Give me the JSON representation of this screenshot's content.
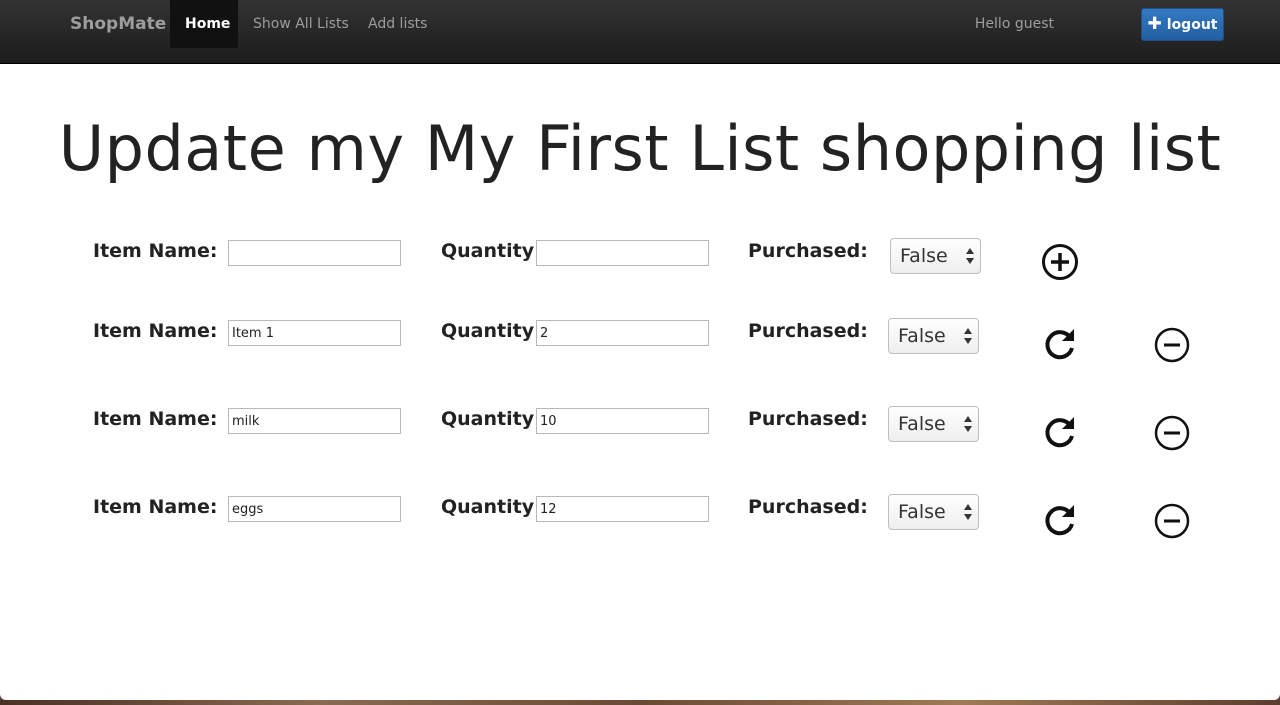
{
  "navbar": {
    "brand": "ShopMate",
    "items": [
      {
        "label": "Home",
        "active": true
      },
      {
        "label": "Show All Lists",
        "active": false
      },
      {
        "label": "Add lists",
        "active": false
      }
    ],
    "greeting": "Hello guest",
    "logout_label": "logout",
    "logout_icon": "plus-icon",
    "logout_color": "#2a6ab0"
  },
  "main": {
    "title": "Update my My First List shopping list",
    "labels": {
      "item_name": "Item Name:",
      "quantity": "Quantity:",
      "purchased": "Purchased:"
    },
    "new_row": {
      "item_name": "",
      "quantity": "",
      "purchased": "False",
      "action_icon": "add-circle-icon"
    },
    "items": [
      {
        "item_name": "Item 1",
        "quantity": "2",
        "purchased": "False",
        "update_icon": "refresh-icon",
        "delete_icon": "minus-circle-icon"
      },
      {
        "item_name": "milk",
        "quantity": "10",
        "purchased": "False",
        "update_icon": "refresh-icon",
        "delete_icon": "minus-circle-icon"
      },
      {
        "item_name": "eggs",
        "quantity": "12",
        "purchased": "False",
        "update_icon": "refresh-icon",
        "delete_icon": "minus-circle-icon"
      }
    ]
  }
}
